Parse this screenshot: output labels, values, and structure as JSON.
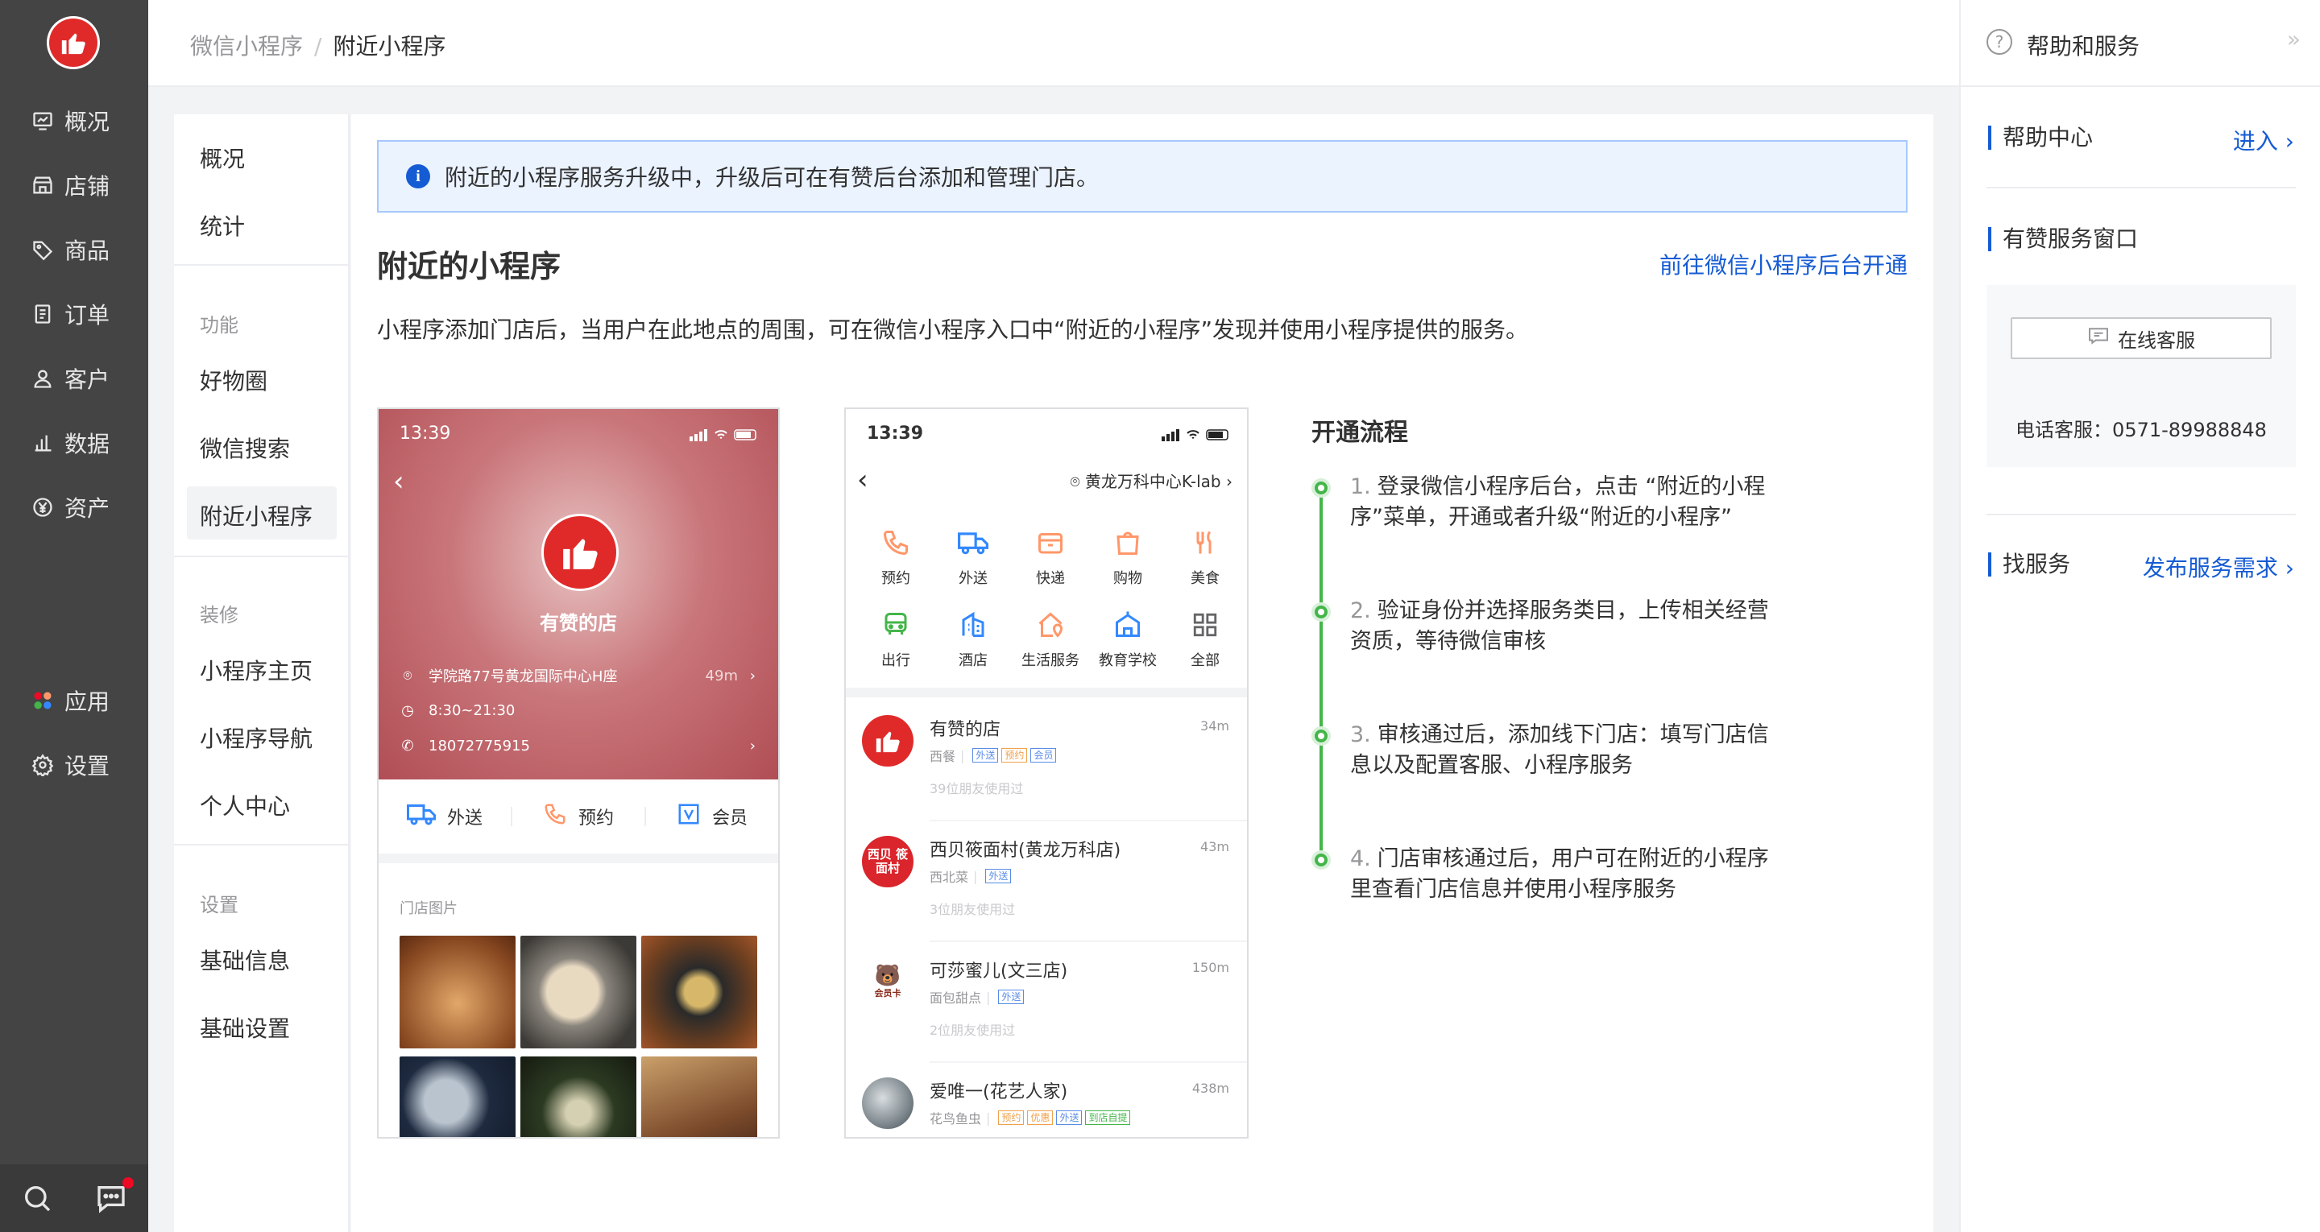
{
  "nav": {
    "items": [
      {
        "label": "概况",
        "icon": "dashboard-icon"
      },
      {
        "label": "店铺",
        "icon": "store-icon"
      },
      {
        "label": "商品",
        "icon": "tag-icon"
      },
      {
        "label": "订单",
        "icon": "order-icon"
      },
      {
        "label": "客户",
        "icon": "user-icon"
      },
      {
        "label": "数据",
        "icon": "bar-chart-icon"
      },
      {
        "label": "资产",
        "icon": "yuan-icon"
      },
      {
        "label": "应用",
        "icon": "apps-icon"
      },
      {
        "label": "设置",
        "icon": "gear-icon"
      }
    ]
  },
  "breadcrumb": {
    "parent": "微信小程序",
    "separator": "/",
    "current": "附近小程序"
  },
  "subnav": {
    "top": [
      "概况",
      "统计"
    ],
    "group1": "功能",
    "group1_items": [
      "好物圈",
      "微信搜索",
      "附近小程序"
    ],
    "group2": "装修",
    "group2_items": [
      "小程序主页",
      "小程序导航",
      "个人中心"
    ],
    "group3": "设置",
    "group3_items": [
      "基础信息",
      "基础设置"
    ]
  },
  "notice": "附近的小程序服务升级中，升级后可在有赞后台添加和管理门店。",
  "title": "附近的小程序",
  "action_link": "前往微信小程序后台开通",
  "description": "小程序添加门店后，当用户在此地点的周围，可在微信小程序入口中“附近的小程序”发现并使用小程序提供的服务。",
  "phone1": {
    "time": "13:39",
    "store": "有赞的店",
    "address": "学院路77号黄龙国际中心H座",
    "distance": "49m",
    "hours": "8:30~21:30",
    "phone": "18072775915",
    "actions": [
      "外送",
      "预约",
      "会员"
    ],
    "section": "门店图片"
  },
  "phone2": {
    "time": "13:39",
    "location": "黄龙万科中心K-lab",
    "categories": [
      "预约",
      "外送",
      "快递",
      "购物",
      "美食",
      "出行",
      "酒店",
      "生活服务",
      "教育学校",
      "全部"
    ],
    "shops": [
      {
        "name": "有赞的店",
        "dist": "34m",
        "cat": "西餐",
        "tags": [
          "外送",
          "预约",
          "会员"
        ],
        "friends": "39位朋友使用过"
      },
      {
        "name": "西贝筱面村(黄龙万科店)",
        "dist": "43m",
        "cat": "西北菜",
        "tags": [
          "外送"
        ],
        "friends": "3位朋友使用过",
        "avatar_text": "西贝 筱面村"
      },
      {
        "name": "可莎蜜儿(文三店)",
        "dist": "150m",
        "cat": "面包甜点",
        "tags": [
          "外送"
        ],
        "friends": "2位朋友使用过",
        "avatar_text": "会员卡"
      },
      {
        "name": "爱唯一(花艺人家)",
        "dist": "438m",
        "cat": "花鸟鱼虫",
        "tags": [
          "预约",
          "优惠",
          "外送",
          "到店自提"
        ],
        "friends": ""
      }
    ]
  },
  "flow": {
    "title": "开通流程",
    "steps": [
      {
        "n": "1.",
        "text": "登录微信小程序后台，点击 “附近的小程序”菜单，开通或者升级“附近的小程序”"
      },
      {
        "n": "2.",
        "text": "验证身份并选择服务类目，上传相关经营资质，等待微信审核"
      },
      {
        "n": "3.",
        "text": "审核通过后，添加线下门店：填写门店信息以及配置客服、小程序服务"
      },
      {
        "n": "4.",
        "text": "门店审核通过后，用户可在附近的小程序里查看门店信息并使用小程序服务"
      }
    ]
  },
  "help": {
    "title": "帮助和服务",
    "help_center": "帮助中心",
    "enter": "进入",
    "service_window": "有赞服务窗口",
    "online_btn": "在线客服",
    "phone": "电话客服：0571-89988848",
    "find_service": "找服务",
    "publish": "发布服务需求"
  },
  "colors": {
    "brand_red": "#e02a2a",
    "link_blue": "#155bd4",
    "flow_green": "#44b549",
    "nav_dark": "#444444"
  }
}
